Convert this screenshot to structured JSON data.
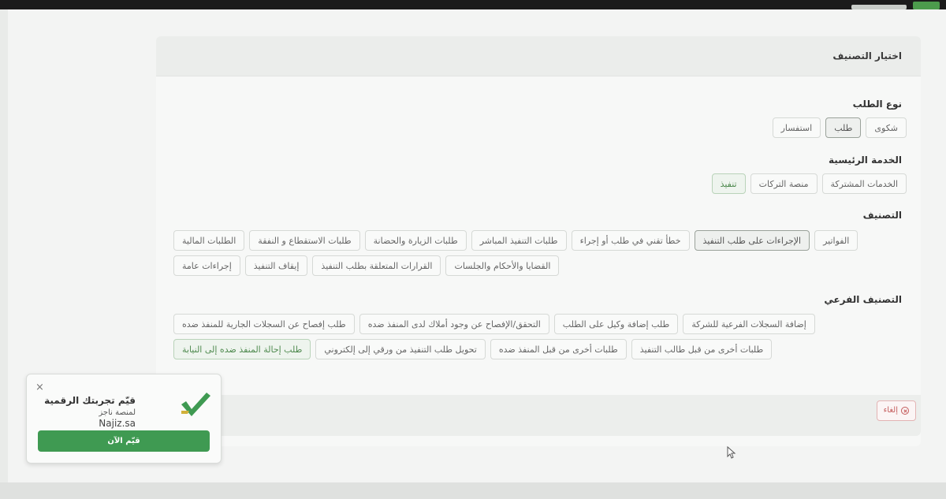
{
  "card": {
    "title": "اختيار التصنيف",
    "request_type": {
      "label": "نوع الطلب",
      "options": [
        "استفسار",
        "طلب",
        "شكوى"
      ]
    },
    "main_service": {
      "label": "الخدمة الرئيسية",
      "options": [
        "تنفيذ",
        "منصة التركات",
        "الخدمات المشتركة"
      ]
    },
    "classification": {
      "label": "التصنيف",
      "options": [
        "الطلبات المالية",
        "طلبات الاستقطاع و النفقة",
        "طلبات الزيارة والحضانة",
        "طلبات التنفيذ المباشر",
        "خطأ تقني في طلب أو إجراء",
        "الإجراءات على طلب التنفيذ",
        "الفواتير",
        "إجراءات عامة",
        "إيقاف التنفيذ",
        "القرارات المتعلقة بطلب التنفيذ",
        "القضايا والأحكام والجلسات"
      ]
    },
    "sub_classification": {
      "label": "التصنيف الفرعي",
      "options": [
        "طلب إفصاح عن السجلات الجارية للمنفذ ضده",
        "التحقق/الإفصاح عن وجود أملاك لدى المنفذ ضده",
        "طلب إضافة وكيل على الطلب",
        "إضافة السجلات الفرعية للشركة",
        "طلب إحالة المنفذ ضده إلى النيابة",
        "تحويل طلب التنفيذ من ورقي إلى إلكتروني",
        "طلبات أخرى من قبل المنفذ ضده",
        "طلبات أخرى من قبل طالب التنفيذ"
      ]
    },
    "cancel_label": "إلغاء"
  },
  "toast": {
    "title": "قيّم تجربتك الرقمية",
    "subtitle": "لمنصة ناجز",
    "site": "Najiz.sa",
    "rate_label": "قيّم الآن",
    "close": "×"
  },
  "colors": {
    "accent_green": "#3f9a52",
    "cancel_red": "#c45b5b"
  }
}
